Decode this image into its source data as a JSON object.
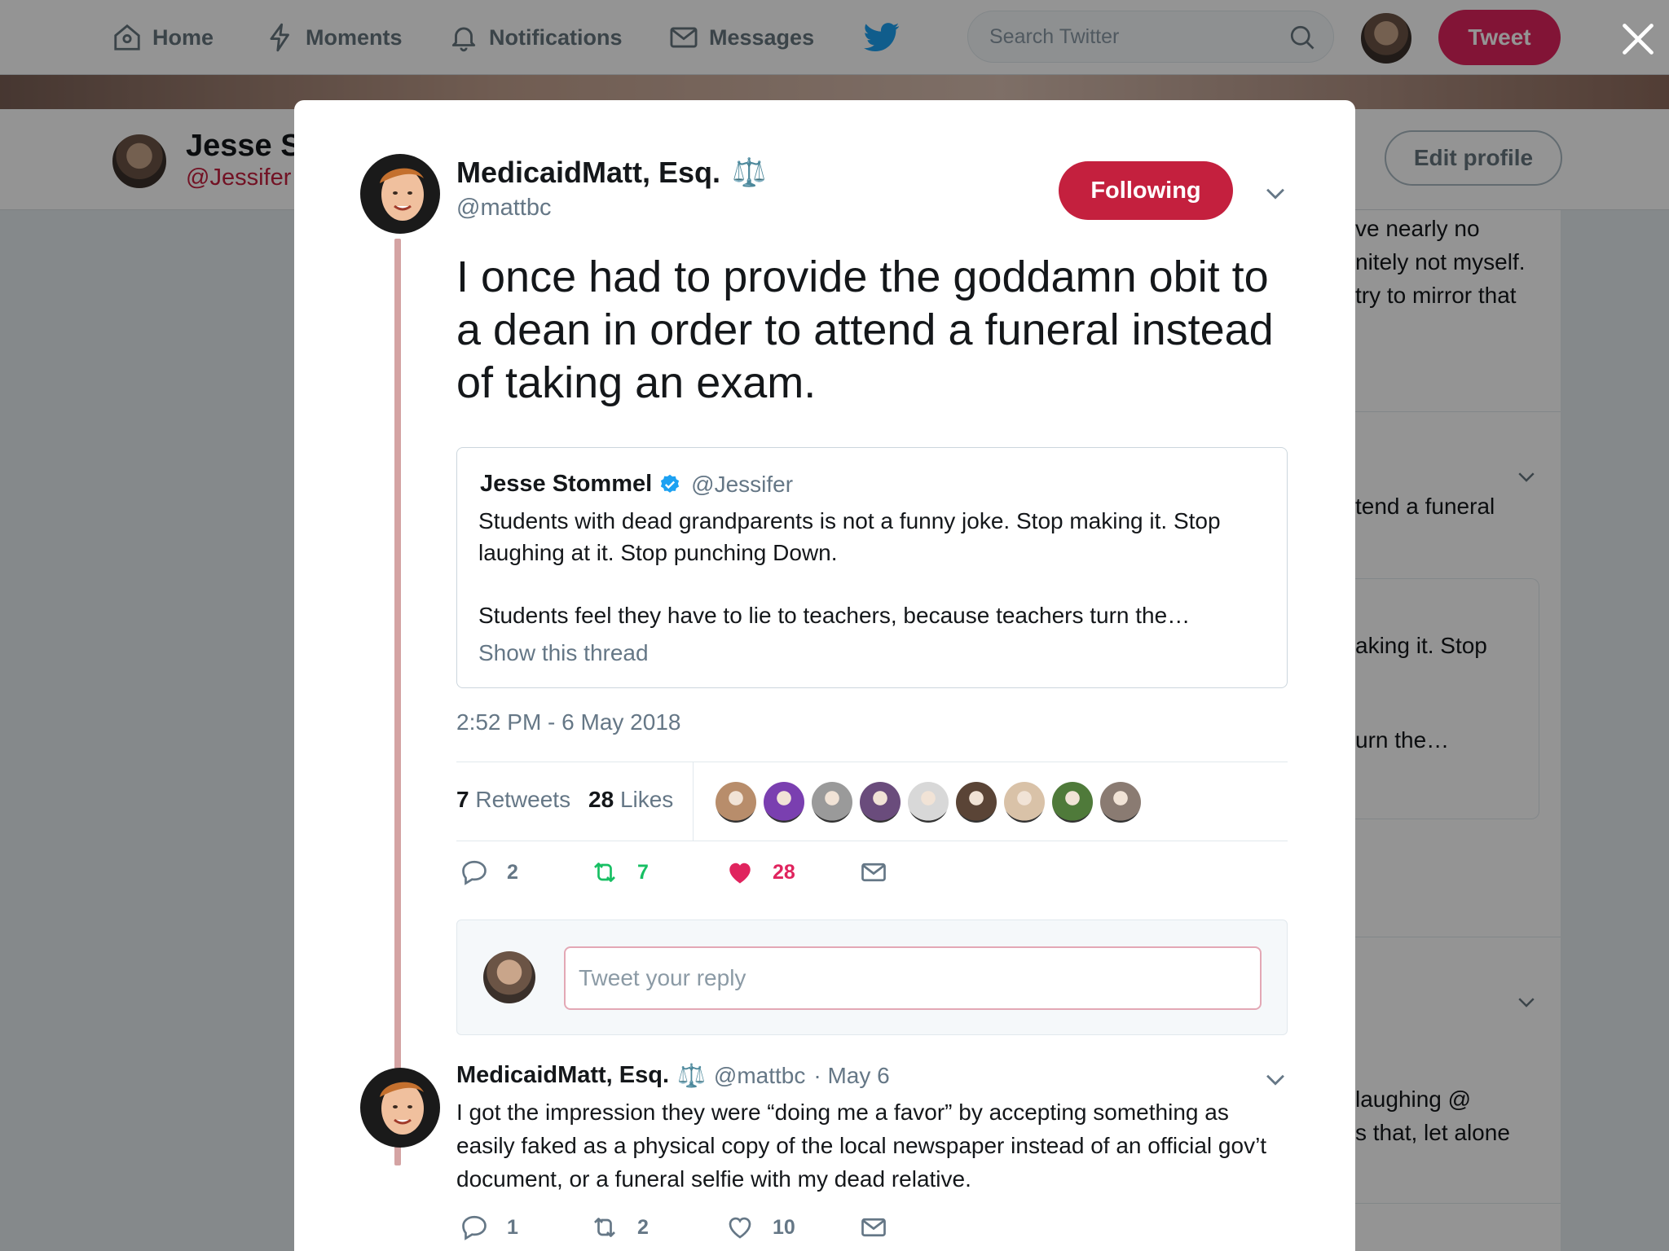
{
  "nav": {
    "home": "Home",
    "moments": "Moments",
    "notifications": "Notifications",
    "messages": "Messages",
    "search_placeholder": "Search Twitter",
    "tweet_button": "Tweet"
  },
  "profile": {
    "name": "Jesse S",
    "handle": "@Jessifer",
    "edit_profile": "Edit profile"
  },
  "background_snippets": [
    "ve nearly no",
    "nitely not myself.",
    "try to mirror that",
    "tend a funeral",
    "aking it. Stop",
    "urn the…",
    "laughing @",
    "s that, let alone"
  ],
  "tweet": {
    "author_name": "MedicaidMatt, Esq.",
    "author_emoji": "⚖️",
    "author_handle": "@mattbc",
    "follow_state": "Following",
    "text": "I once had to provide the goddamn obit to a dean in order to attend a funeral instead of taking an exam.",
    "quoted": {
      "name": "Jesse Stommel",
      "handle": "@Jessifer",
      "text": "Students with dead grandparents is not a funny joke. Stop making it. Stop laughing at it. Stop punching Down.",
      "text2": "Students feel they have to lie to teachers, because teachers turn the…",
      "show_thread": "Show this thread"
    },
    "timestamp": "2:52 PM - 6 May 2018",
    "retweets_count": "7",
    "retweets_label": "Retweets",
    "likes_count": "28",
    "likes_label": "Likes",
    "actions": {
      "replies": "2",
      "retweets": "7",
      "likes": "28"
    },
    "liker_colors": [
      "#b88d6b",
      "#7a3fb0",
      "#9a9a9a",
      "#6a4c7c",
      "#d8d8d8",
      "#5a4436",
      "#d9c2a8",
      "#4f7a3a",
      "#8a7b72"
    ]
  },
  "reply_box": {
    "placeholder": "Tweet your reply"
  },
  "reply": {
    "author_name": "MedicaidMatt, Esq.",
    "author_emoji": "⚖️",
    "author_handle": "@mattbc",
    "date": "· May 6",
    "text": "I got the impression they were “doing me a favor” by accepting something as easily faked as a physical copy of the local newspaper instead of an official gov’t document, or a funeral selfie with my dead relative.",
    "actions": {
      "replies": "1",
      "retweets": "2",
      "likes": "10"
    }
  },
  "colors": {
    "accent": "#c4203e",
    "retweet_green": "#17bf63",
    "like_red": "#e0245e",
    "muted": "#657786"
  }
}
